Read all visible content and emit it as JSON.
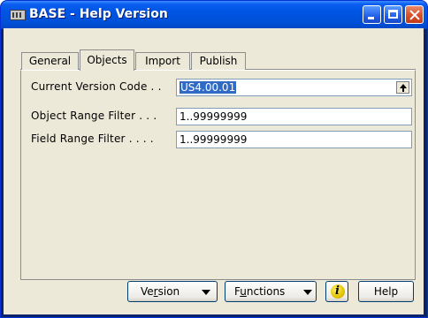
{
  "window": {
    "title": "BASE - Help Version",
    "controls": [
      "minimize",
      "maximize",
      "close"
    ]
  },
  "tabs": [
    {
      "label": "General",
      "selected": false
    },
    {
      "label": "Objects",
      "selected": true
    },
    {
      "label": "Import",
      "selected": false
    },
    {
      "label": "Publish",
      "selected": false
    }
  ],
  "fields": {
    "current_version_code": {
      "label": "Current Version Code . .",
      "value": "US4.00.01"
    },
    "object_range_filter": {
      "label": "Object Range Filter . . .",
      "value": "1..99999999"
    },
    "field_range_filter": {
      "label": "Field Range Filter . . . .",
      "value": "1..99999999"
    }
  },
  "buttons": {
    "version": {
      "pre": "Ve",
      "accel": "r",
      "post": "sion"
    },
    "functions": {
      "pre": "F",
      "accel": "u",
      "post": "nctions"
    },
    "help": "Help"
  },
  "icons": {
    "app": "table-icon",
    "lookup": "lookup-arrow-icon",
    "info": "info-icon"
  }
}
